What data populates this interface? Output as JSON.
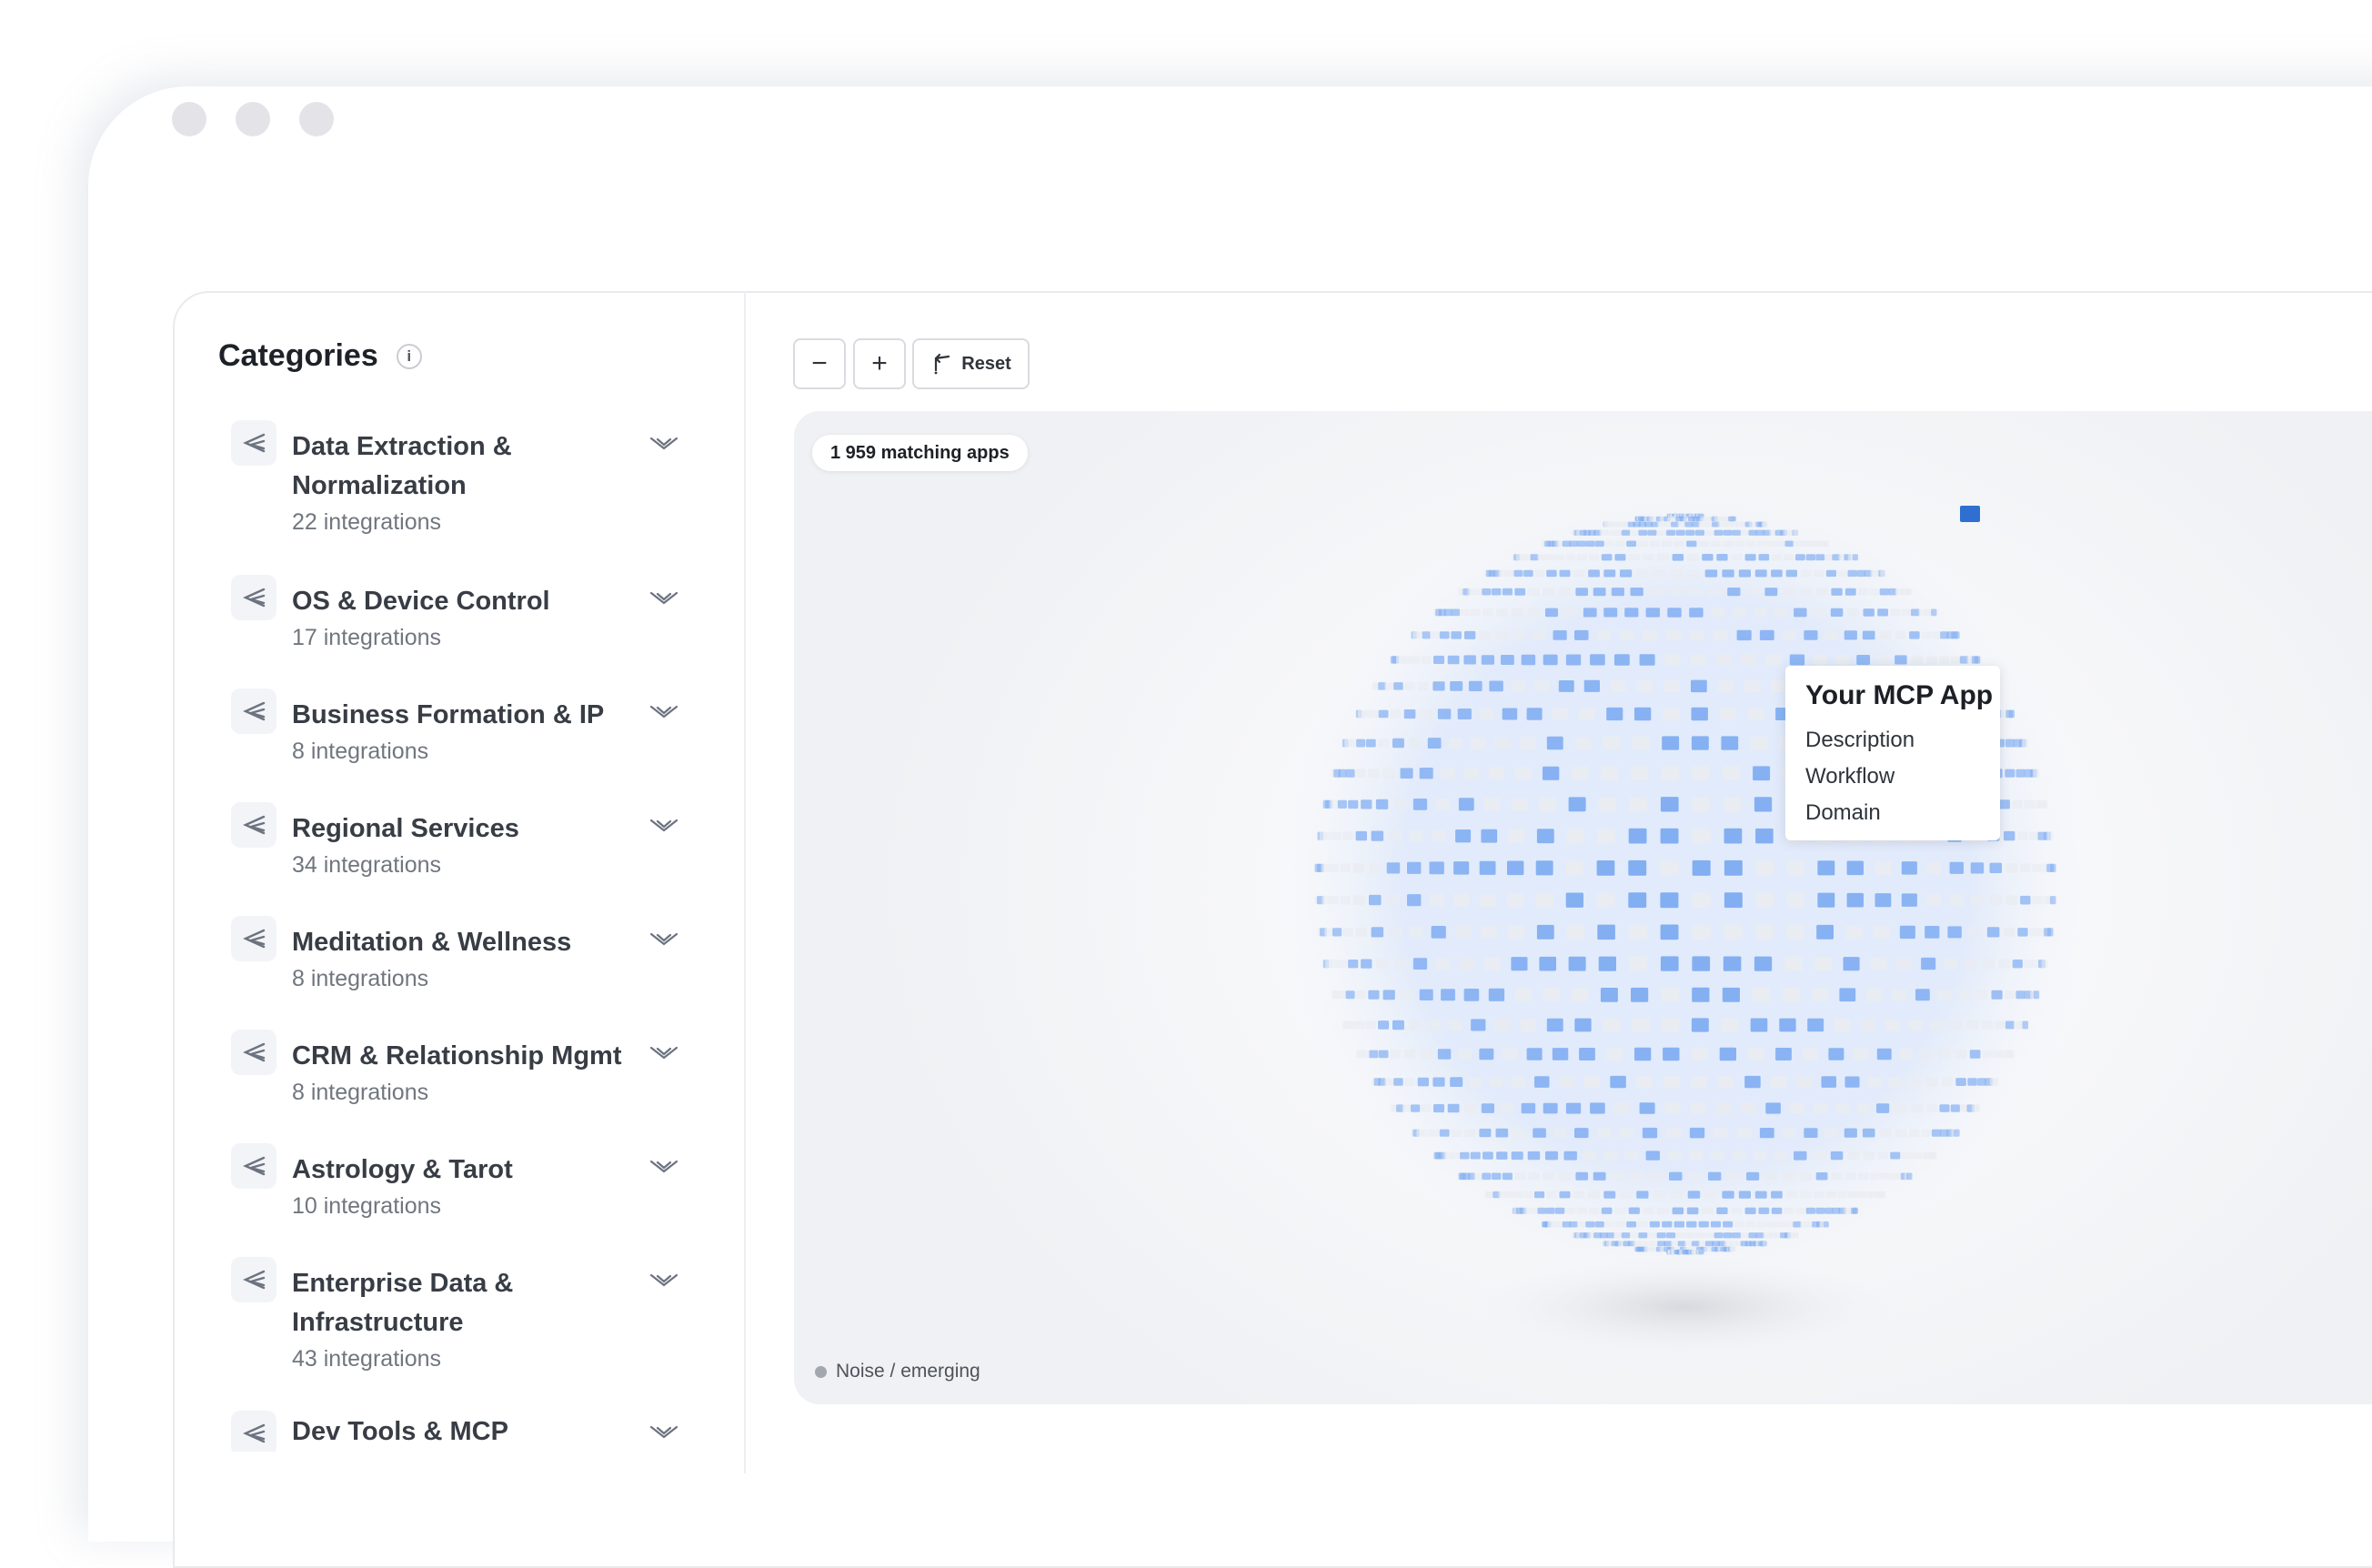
{
  "window": {
    "controls": [
      "close",
      "minimize",
      "maximize"
    ]
  },
  "sidebar": {
    "title": "Categories",
    "info_icon": "i",
    "items": [
      {
        "name": "Data Extraction & Normalization",
        "count": "22 integrations"
      },
      {
        "name": "OS & Device Control",
        "count": "17 integrations"
      },
      {
        "name": "Business Formation & IP",
        "count": "8 integrations"
      },
      {
        "name": "Regional Services",
        "count": "34 integrations"
      },
      {
        "name": "Meditation & Wellness",
        "count": "8 integrations"
      },
      {
        "name": "CRM & Relationship Mgmt",
        "count": "8 integrations"
      },
      {
        "name": "Astrology & Tarot",
        "count": "10 integrations"
      },
      {
        "name": "Enterprise Data & Infrastructure",
        "count": "43 integrations"
      },
      {
        "name": "Dev Tools & MCP",
        "count": ""
      }
    ]
  },
  "toolbar": {
    "zoom_out": "−",
    "zoom_in": "+",
    "reset_label": "Reset"
  },
  "map": {
    "matching_label": "1 959 matching apps",
    "legend_label": "Noise / emerging",
    "tooltip": {
      "title": "Your MCP App",
      "items": [
        "Description",
        "Workflow",
        "Domain"
      ]
    }
  },
  "colors": {
    "tile_primary": "#82aef2",
    "tile_light": "#e9ecf1",
    "tile_highlight": "#2f6fd1"
  }
}
